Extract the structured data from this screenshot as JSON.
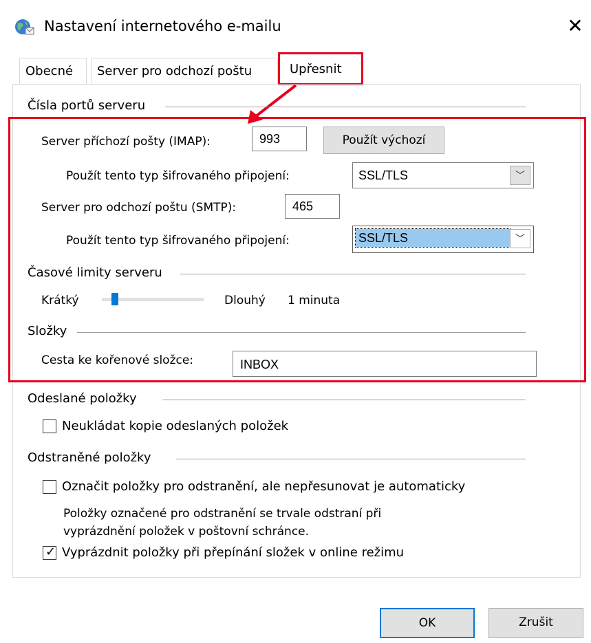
{
  "window": {
    "title": "Nastavení internetového e-mailu",
    "close_glyph": "✕",
    "icon": "globe-mail-icon"
  },
  "tabs": [
    {
      "label": "Obecné",
      "active": false
    },
    {
      "label": "Server pro odchozí poštu",
      "active": false
    },
    {
      "label": "Upřesnit",
      "active": true
    }
  ],
  "ports": {
    "group_title": "Čísla portů serveru",
    "incoming_label": "Server příchozí pošty (IMAP):",
    "incoming_value": "993",
    "default_button": "Použít výchozí",
    "incoming_enc_label": "Použít tento typ šifrovaného připojení:",
    "incoming_enc_value": "SSL/TLS",
    "outgoing_label": "Server pro odchozí poštu (SMTP):",
    "outgoing_value": "465",
    "outgoing_enc_label": "Použít tento typ šifrovaného připojení:",
    "outgoing_enc_value": "SSL/TLS"
  },
  "timeouts": {
    "group_title": "Časové limity serveru",
    "short_label": "Krátký",
    "long_label": "Dlouhý",
    "value_label": "1 minuta",
    "slider_level": 0.1
  },
  "folders": {
    "group_title": "Složky",
    "root_label": "Cesta ke kořenové složce:",
    "root_value": "INBOX"
  },
  "sent": {
    "group_title": "Odeslané položky",
    "no_copies_label": "Neukládat kopie odeslaných položek",
    "no_copies_checked": false
  },
  "deleted": {
    "group_title": "Odstraněné položky",
    "mark_label": "Označit položky pro odstranění, ale nepřesunovat je automaticky",
    "mark_checked": false,
    "note_line1": "Položky označené pro odstranění se trvale odstraní při",
    "note_line2": "vyprázdnění položek v poštovní schránce.",
    "purge_label": "Vyprázdnit položky při přepínání složek v online režimu",
    "purge_checked": true,
    "check_glyph": "✓"
  },
  "footer": {
    "ok_label": "OK",
    "cancel_label": "Zrušit"
  },
  "colors": {
    "annotation": "#e8001c",
    "focus": "#0078d7",
    "selection": "#99c9ef"
  }
}
